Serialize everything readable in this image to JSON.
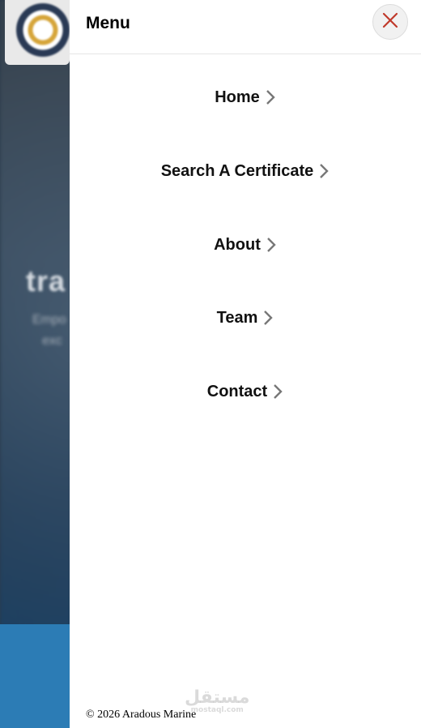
{
  "background": {
    "hero_text": "tra",
    "sub_line_1": "Empo",
    "sub_line_2": "exc"
  },
  "drawer": {
    "title": "Menu",
    "close_icon": "close-icon",
    "nav_items": [
      {
        "label": "Home",
        "icon": "chevron-right-icon"
      },
      {
        "label": "Search A Certificate",
        "icon": "chevron-right-icon"
      },
      {
        "label": "About",
        "icon": "chevron-right-icon"
      },
      {
        "label": "Team",
        "icon": "chevron-right-icon"
      },
      {
        "label": "Contact",
        "icon": "chevron-right-icon"
      }
    ],
    "footer": "© 2026 Aradous Marine"
  },
  "watermark": {
    "arabic": "مستقل",
    "latin": "mostaql.com"
  },
  "colors": {
    "close_icon": "#c0392b",
    "chevron": "#777777",
    "drawer_bg": "#ffffff"
  }
}
